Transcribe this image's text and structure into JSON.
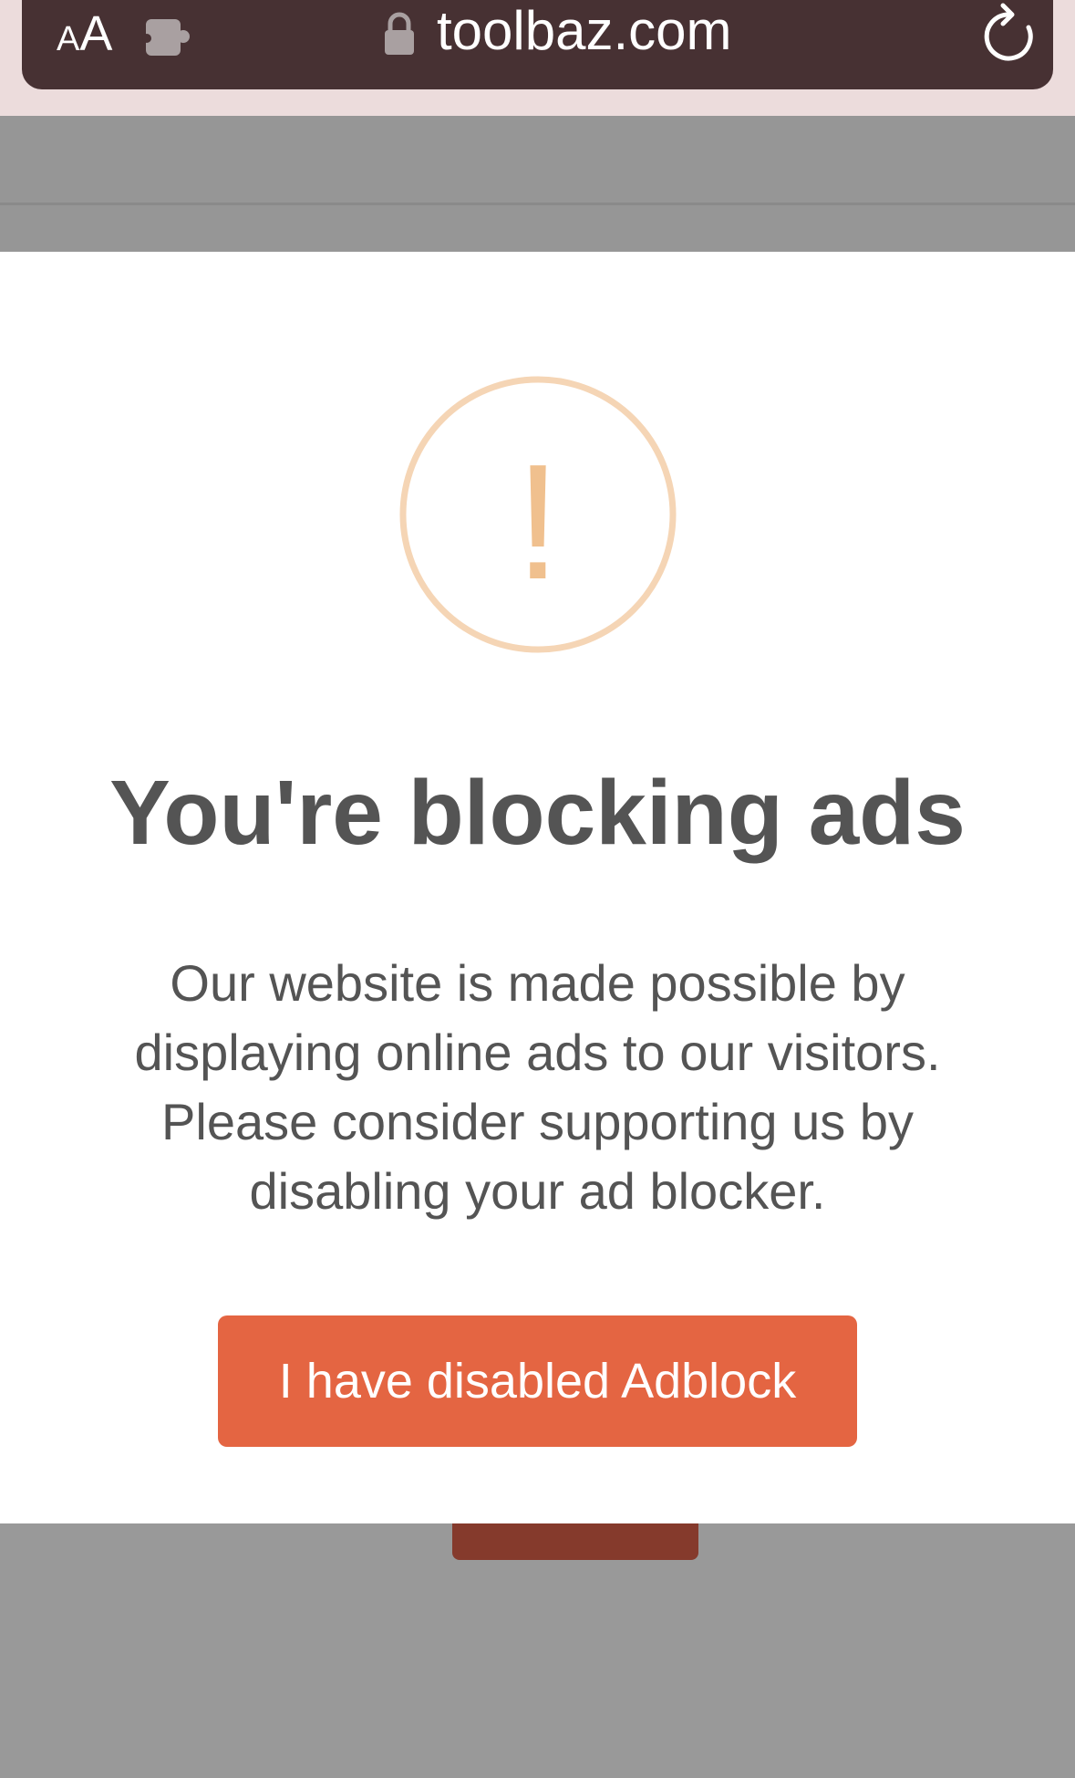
{
  "browser": {
    "text_size_label_small": "A",
    "text_size_label_big": "A",
    "url": "toolbaz.com",
    "icons": {
      "text_size": "text-size-icon",
      "extension": "extension-puzzle-icon",
      "lock": "lock-icon",
      "reload": "reload-icon"
    }
  },
  "modal": {
    "icon": "exclamation-circle-icon",
    "icon_glyph": "!",
    "title": "You're blocking ads",
    "message": "Our website is made possible by displaying online ads to our visitors. Please consider supporting us by disabling your ad blocker.",
    "button_label": "I have disabled Adblock"
  },
  "colors": {
    "chrome_bar": "#473133",
    "warning_circle": "#f5d5b5",
    "warning_mark": "#f0c08e",
    "text": "#545454",
    "button": "#e46542",
    "overlay": "#999999"
  }
}
